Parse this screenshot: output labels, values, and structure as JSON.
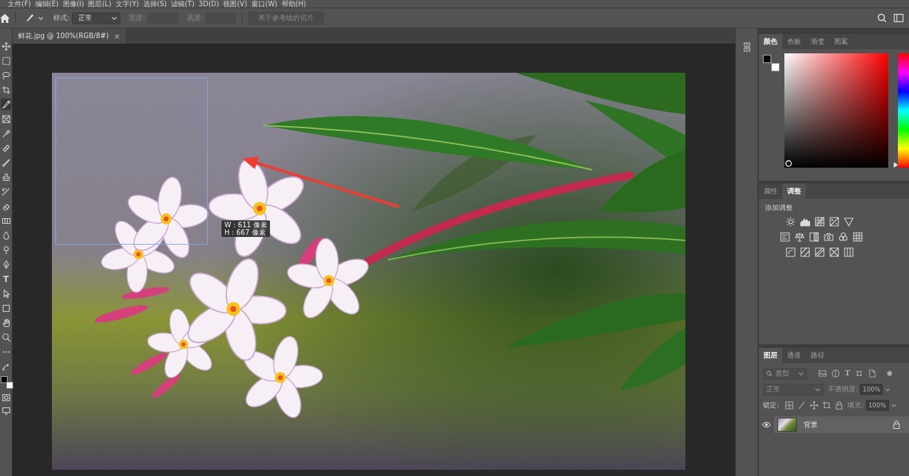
{
  "menu_bar": {
    "items": [
      "文件(F)",
      "编辑(E)",
      "图像(I)",
      "图层(L)",
      "文字(Y)",
      "选择(S)",
      "滤镜(T)",
      "3D(D)",
      "视图(V)",
      "窗口(W)",
      "帮助(H)"
    ]
  },
  "options_bar": {
    "style_label": "样式:",
    "style_value": "正常",
    "width_label": "宽度:",
    "width_field": {
      "disabled": true
    },
    "height_label": "高度:",
    "height_field": {
      "disabled": true
    },
    "slice_button": {
      "label": "基于参考线的切片",
      "disabled": true
    }
  },
  "toolbar": {
    "tools": [
      {
        "kind": "move",
        "selected": false
      },
      {
        "kind": "marquee",
        "selected": false
      },
      {
        "kind": "lasso",
        "selected": false
      },
      {
        "kind": "crop",
        "selected": false
      },
      {
        "kind": "slice",
        "selected": true
      },
      {
        "kind": "frame",
        "selected": false
      },
      {
        "kind": "eyedropper",
        "selected": false
      },
      {
        "kind": "healing",
        "selected": false
      },
      {
        "kind": "brush",
        "selected": false
      },
      {
        "kind": "stamp",
        "selected": false
      },
      {
        "kind": "history",
        "selected": false
      },
      {
        "kind": "eraser",
        "selected": false
      },
      {
        "kind": "gradient",
        "selected": false
      },
      {
        "kind": "blur",
        "selected": false
      },
      {
        "kind": "dodge",
        "selected": false
      },
      {
        "kind": "pen",
        "selected": false
      },
      {
        "kind": "type",
        "glyph": "T",
        "selected": false
      },
      {
        "kind": "path",
        "selected": false
      },
      {
        "kind": "rectangle",
        "selected": false
      },
      {
        "kind": "hand",
        "selected": false
      },
      {
        "kind": "zoom",
        "selected": false
      },
      {
        "kind": "more",
        "selected": false
      }
    ]
  },
  "document": {
    "tab": {
      "title": "鲜花.jpg @ 100%(RGB/8#)",
      "close": "×"
    },
    "slice_tooltip": {
      "width_text": "W : 611 像素",
      "height_text": "H : 667 像素"
    }
  },
  "color_panel": {
    "tabs": [
      {
        "label": "颜色",
        "selected": true
      },
      {
        "label": "色板",
        "selected": false
      },
      {
        "label": "渐变",
        "selected": false
      },
      {
        "label": "图案",
        "selected": false
      }
    ],
    "hue_slider": {
      "level": 0
    }
  },
  "adjustments_panel": {
    "tabs": [
      {
        "label": "属性",
        "selected": false
      },
      {
        "label": "调整",
        "selected": true
      }
    ],
    "heading": "添加调整"
  },
  "layers_panel": {
    "tabs": [
      {
        "label": "图层",
        "selected": true
      },
      {
        "label": "通道",
        "selected": false
      },
      {
        "label": "路径",
        "selected": false
      }
    ],
    "filter": {
      "value": "类型",
      "type_glyph": "T",
      "disabled": true
    },
    "blend_mode": {
      "value": "正常",
      "disabled": true
    },
    "opacity": {
      "label": "不透明度:",
      "value": "100%",
      "disabled": true
    },
    "lock_label": "锁定:",
    "fill": {
      "label": "填充:",
      "value": "100%",
      "disabled": true
    },
    "layers": [
      {
        "name": "背景",
        "visible": true,
        "locked": true,
        "selected": true
      }
    ]
  }
}
